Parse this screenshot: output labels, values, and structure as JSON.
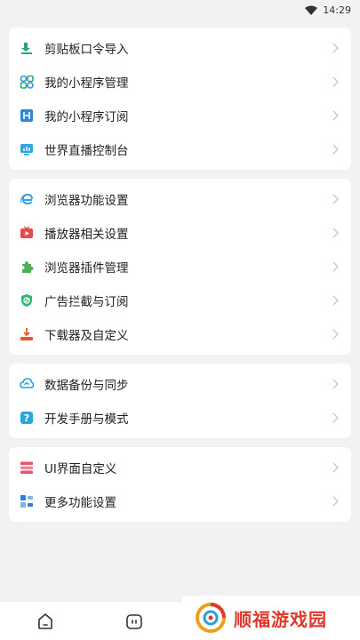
{
  "status": {
    "time": "14:29"
  },
  "groups": [
    {
      "items": [
        {
          "label": "剪贴板口令导入",
          "icon": "clipboard-import-icon",
          "color": "#2aa775"
        },
        {
          "label": "我的小程序管理",
          "icon": "mini-app-manage-icon",
          "color": "#3a8ee6"
        },
        {
          "label": "我的小程序订阅",
          "icon": "mini-app-subscribe-icon",
          "color": "#2f86d6"
        },
        {
          "label": "世界直播控制台",
          "icon": "live-console-icon",
          "color": "#2fa6e0"
        }
      ]
    },
    {
      "items": [
        {
          "label": "浏览器功能设置",
          "icon": "browser-settings-icon",
          "color": "#3aa0e6"
        },
        {
          "label": "播放器相关设置",
          "icon": "player-settings-icon",
          "color": "#e64a4a"
        },
        {
          "label": "浏览器插件管理",
          "icon": "plugin-manage-icon",
          "color": "#4caf50"
        },
        {
          "label": "广告拦截与订阅",
          "icon": "adblock-icon",
          "color": "#2eb872"
        },
        {
          "label": "下载器及自定义",
          "icon": "downloader-icon",
          "color": "#e8552f"
        }
      ]
    },
    {
      "items": [
        {
          "label": "数据备份与同步",
          "icon": "backup-sync-icon",
          "color": "#2d9fe6"
        },
        {
          "label": "开发手册与模式",
          "icon": "dev-manual-icon",
          "color": "#2aa7d8"
        }
      ]
    },
    {
      "items": [
        {
          "label": "UI界面自定义",
          "icon": "ui-customize-icon",
          "color": "#e8556a"
        },
        {
          "label": "更多功能设置",
          "icon": "more-settings-icon",
          "color": "#2f7fe0"
        }
      ]
    }
  ],
  "watermark": {
    "text": "顺福游戏园",
    "color": "#e0382b"
  }
}
